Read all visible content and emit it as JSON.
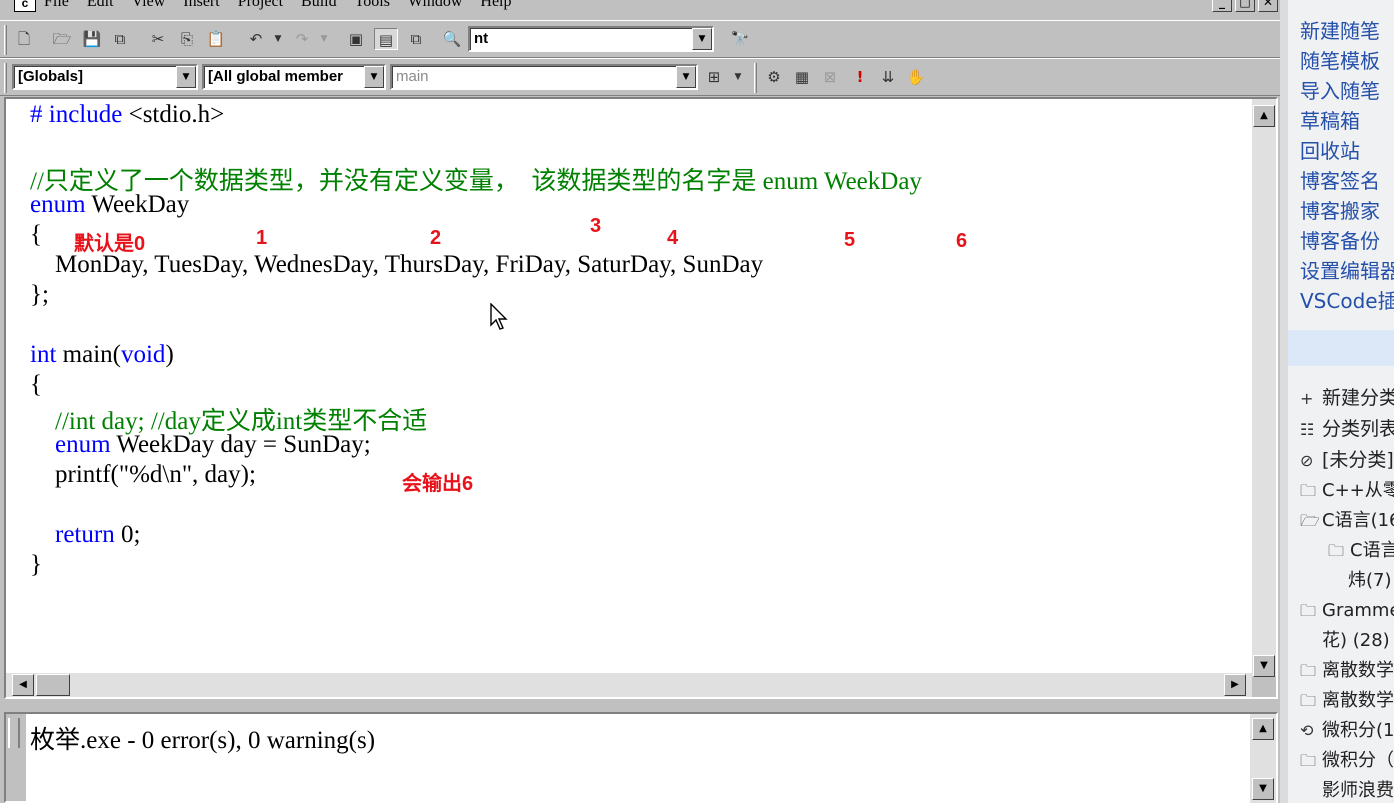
{
  "menubar": {
    "app_icon": "c",
    "menus": [
      "File",
      "Edit",
      "View",
      "Insert",
      "Project",
      "Build",
      "Tools",
      "Window",
      "Help"
    ],
    "win_buttons": [
      "_",
      "□",
      "✕"
    ]
  },
  "toolbar1": {
    "icons": [
      "new-file-icon",
      "open-folder-icon",
      "save-icon",
      "save-all-icon",
      "cut-icon",
      "copy-icon",
      "paste-icon",
      "undo-icon",
      "redo-icon",
      "workspace-icon",
      "output-icon",
      "window-list-icon",
      "find-in-files-icon",
      "find-icon"
    ],
    "search_value": "nt"
  },
  "toolbar2": {
    "class_combo": "[Globals]",
    "member_combo": "[All global member",
    "function_combo": "main",
    "icons": [
      "wizard-icon",
      "compile-icon",
      "build-icon",
      "stop-build-icon",
      "execute-icon",
      "go-icon",
      "breakpoint-icon"
    ]
  },
  "code": {
    "l1_directive": "# include",
    "l1_header": " <stdio.h>",
    "l2_comment": "//只定义了一个数据类型，并没有定义变量，  该数据类型的名字是 enum WeekDay",
    "l3_kw": "enum",
    "l3_rest": " WeekDay",
    "l4": "{",
    "l5": "    MonDay, TuesDay, WednesDay, ThursDay, FriDay, SaturDay, SunDay",
    "l6": "};",
    "l7_kw": "int",
    "l7_mid": " main(",
    "l7_kw2": "void",
    "l7_end": ")",
    "l8": "{",
    "l9_comment": "    //int day; //day定义成int类型不合适",
    "l10_kw": "    enum",
    "l10_rest": " WeekDay day = SunDay;",
    "l11": "    printf(\"%d\\n\", day);",
    "l12_kw": "    return",
    "l12_rest": " 0;",
    "l13": "}"
  },
  "annotations": {
    "default": "默认是0",
    "n1": "1",
    "n2": "2",
    "n3": "3",
    "n4": "4",
    "n5": "5",
    "n6": "6",
    "output_note": "会输出6"
  },
  "output": {
    "text": "枚举.exe - 0 error(s), 0 warning(s)"
  },
  "blog": {
    "links": [
      "新建随笔",
      "随笔模板",
      "导入随笔",
      "草稿箱",
      "回收站",
      "博客签名",
      "博客搬家",
      "博客备份",
      "设置编辑器",
      "VSCode插件"
    ],
    "categories": [
      {
        "icon": "plus-icon",
        "glyph": "+",
        "label": "新建分类"
      },
      {
        "icon": "list-icon",
        "glyph": "☷",
        "label": "分类列表"
      },
      {
        "icon": "folder-slash-icon",
        "glyph": "⊘",
        "label": "[未分类]"
      },
      {
        "icon": "folder-icon",
        "glyph": "🗀",
        "label": "C++从零"
      },
      {
        "icon": "folder-open-icon",
        "glyph": "🗁",
        "label": "C语言(16"
      },
      {
        "icon": "folder-icon",
        "glyph": "🗀",
        "label": "C语言"
      },
      {
        "icon": "",
        "glyph": "",
        "label": "炜(7)"
      },
      {
        "icon": "folder-icon",
        "glyph": "🗀",
        "label": "Grammer"
      },
      {
        "icon": "",
        "glyph": "",
        "label": "花)  (28)"
      },
      {
        "icon": "folder-icon",
        "glyph": "🗀",
        "label": "离散数学"
      },
      {
        "icon": "folder-icon",
        "glyph": "🗀",
        "label": "离散数学"
      },
      {
        "icon": "folder-sync-icon",
        "glyph": "⟲",
        "label": "微积分(1"
      },
      {
        "icon": "folder-icon",
        "glyph": "🗀",
        "label": "微积分（"
      },
      {
        "icon": "",
        "glyph": "",
        "label": "影师浪费"
      }
    ]
  }
}
